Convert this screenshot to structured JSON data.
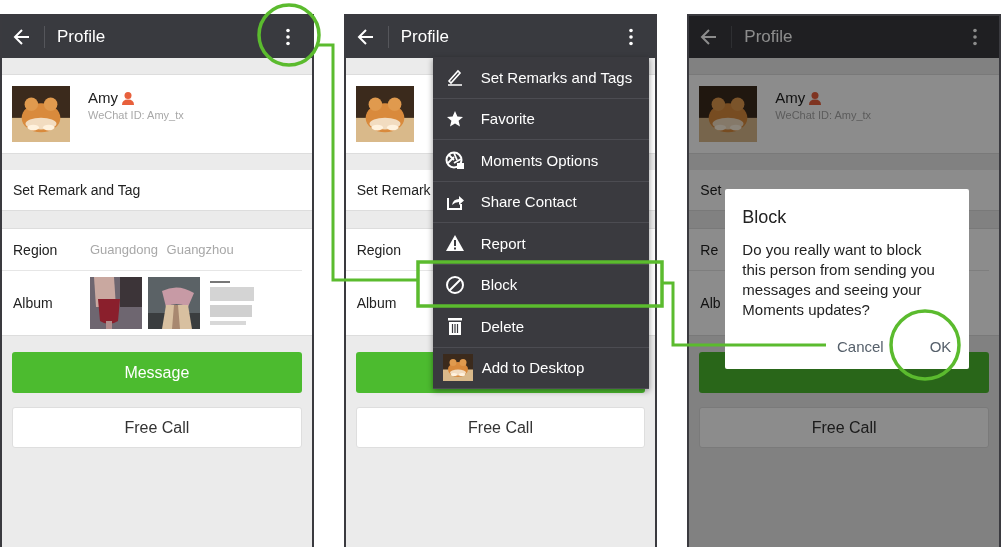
{
  "screens": [
    {
      "dimmed": false,
      "header": {
        "title": "Profile"
      },
      "profile": {
        "name": "Amy",
        "wechat_id": "WeChat ID: Amy_tx"
      },
      "remark_row": "Set Remark and Tag",
      "region": {
        "label": "Region",
        "value": "Guangdong Guangzhou"
      },
      "album": {
        "label": "Album"
      },
      "buttons": [
        {
          "kind": "primary",
          "label": "Message"
        },
        {
          "kind": "secondary",
          "label": "Free Call"
        }
      ]
    },
    {
      "dimmed": false,
      "header": {
        "title": "Profile"
      },
      "remark_row": "Set Remark",
      "region": {
        "label": "Region"
      },
      "album": {
        "label": "Album"
      },
      "buttons": [
        {
          "kind": "primary"
        },
        {
          "kind": "secondary",
          "label": "Free Call"
        }
      ],
      "menu": [
        {
          "label": "Set Remarks and Tags"
        },
        {
          "label": "Favorite"
        },
        {
          "label": "Moments Options"
        },
        {
          "label": "Share Contact"
        },
        {
          "label": "Report"
        },
        {
          "label": "Block"
        },
        {
          "label": "Delete"
        },
        {
          "label": "Add to Desktop"
        }
      ]
    },
    {
      "dimmed": true,
      "header": {
        "title": "Profile"
      },
      "profile": {
        "name": "Amy",
        "wechat_id": "WeChat ID: Amy_tx"
      },
      "remark_row": "Set",
      "region": {
        "label": "Re"
      },
      "album": {
        "label": "Alb"
      },
      "buttons": [
        {
          "kind": "primary"
        },
        {
          "kind": "secondary",
          "label": "Free Call"
        }
      ],
      "dialog": {
        "title": "Block",
        "message": "Do you really want to block this person from sending you messages and seeing your Moments updates?",
        "buttons": [
          "Cancel",
          "OK"
        ]
      }
    }
  ]
}
